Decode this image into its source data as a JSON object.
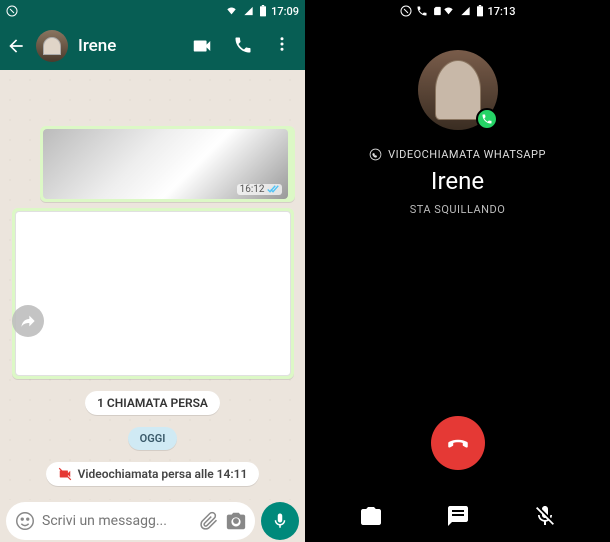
{
  "left": {
    "status": {
      "time": "17:09"
    },
    "header": {
      "contact": "Irene"
    },
    "messages": {
      "media_time": "16:12",
      "missed_call_pill": "1 CHIAMATA PERSA",
      "date_pill": "OGGI",
      "missed_video": "Videochiamata persa alle 14:11"
    },
    "input": {
      "placeholder": "Scrivi un messagg..."
    }
  },
  "right": {
    "status": {
      "time": "17:13"
    },
    "call": {
      "type": "VIDEOCHIAMATA WHATSAPP",
      "name": "Irene",
      "status": "STA SQUILLANDO"
    }
  },
  "colors": {
    "topbar": "#075E54",
    "chat_bg": "#ECE5DD",
    "out_bubble": "#DCF8C6",
    "send": "#00897B",
    "hangup": "#E53935"
  }
}
